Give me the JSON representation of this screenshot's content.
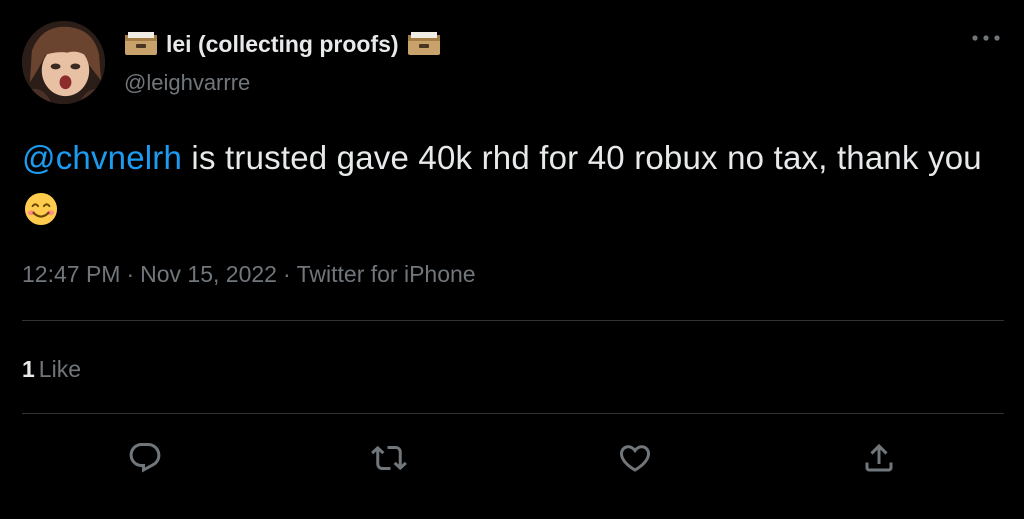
{
  "author": {
    "display_name": "lei (collecting proofs)",
    "handle": "@leighvarrre",
    "name_emoji": "card-file-box-emoji"
  },
  "tweet": {
    "mention": "@chvnelrh",
    "text": " is trusted gave 40k rhd for 40 robux no tax, thank you",
    "emoji": "smiling-face-emoji"
  },
  "meta": {
    "time": "12:47 PM",
    "separator": "·",
    "date": "Nov 15, 2022",
    "source": "Twitter for iPhone"
  },
  "stats": {
    "likes_count": "1",
    "likes_label": "Like"
  },
  "actions": {
    "reply_icon": "reply-icon",
    "retweet_icon": "retweet-icon",
    "like_icon": "heart-icon",
    "share_icon": "share-icon",
    "more_icon": "more-options-icon"
  },
  "colors": {
    "background": "#000000",
    "text_primary": "#e7e9ea",
    "text_secondary": "#71767b",
    "link": "#1d9bf0",
    "divider": "#2f3336"
  }
}
